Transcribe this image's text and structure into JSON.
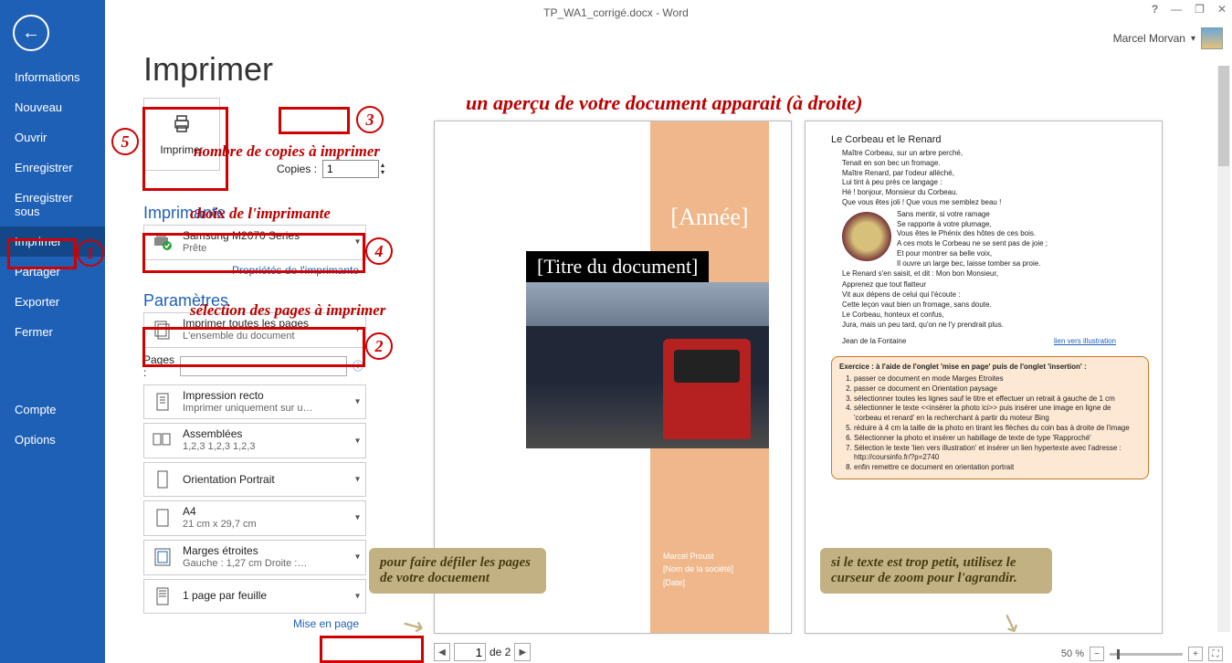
{
  "title": "TP_WA1_corrigé.docx - Word",
  "user": "Marcel Morvan",
  "sidebar": {
    "items": [
      "Informations",
      "Nouveau",
      "Ouvrir",
      "Enregistrer",
      "Enregistrer sous",
      "Imprimer",
      "Partager",
      "Exporter",
      "Fermer",
      "Compte",
      "Options"
    ],
    "active_index": 5
  },
  "print": {
    "heading": "Imprimer",
    "big_button": "Imprimer",
    "copies_label": "Copies :",
    "copies_value": "1",
    "printer_heading": "Imprimante",
    "printer_name": "Samsung M2070 Series",
    "printer_status": "Prête",
    "printer_props": "Propriétés de l'imprimante",
    "settings_heading": "Paramètres",
    "dd_pages_t1": "Imprimer toutes les pages",
    "dd_pages_t2": "L'ensemble du document",
    "pages_label": "Pages :",
    "dd_side_t1": "Impression recto",
    "dd_side_t2": "Imprimer uniquement sur u…",
    "dd_collate_t1": "Assemblées",
    "dd_collate_t2": "1,2,3    1,2,3    1,2,3",
    "dd_orient_t1": "Orientation Portrait",
    "dd_size_t1": "A4",
    "dd_size_t2": "21 cm x 29,7 cm",
    "dd_margin_t1": "Marges étroites",
    "dd_margin_t2": "Gauche :   1,27 cm    Droite :…",
    "dd_ppp_t1": "1 page par feuille",
    "page_setup": "Mise en page"
  },
  "preview": {
    "year": "[Année]",
    "doc_title": "[Titre du document]",
    "meta1": "Marcel Proust",
    "meta2": "[Nom de la société]",
    "meta3": "[Date]",
    "p2_title": "Le Corbeau et le Renard",
    "p2_body1": "Maître Corbeau, sur un arbre perché,\nTenait en son bec un fromage.\nMaître Renard, par l'odeur alléché,\nLui tint à peu près ce langage :\nHé ! bonjour, Monsieur du Corbeau.\nQue vous êtes joli !  Que vous me semblez beau !",
    "p2_body2": "Sans mentir, si votre ramage\nSe rapporte à votre plumage,\nVous êtes le Phénix des hôtes de ces bois.\nA ces mots le Corbeau ne se sent pas de joie ;\nEt pour montrer sa belle voix,\nIl ouvre un large bec, laisse tomber sa proie.\nLe Renard s'en saisit, et dit : Mon bon Monsieur,",
    "p2_body3": "Apprenez que tout flatteur\nVit aux dépens de celui qui l'écoute :\nCette leçon vaut bien un fromage, sans doute.\nLe Corbeau, honteux et confus,\nJura, mais un peu tard, qu'on ne l'y prendrait plus.",
    "p2_author": "Jean de la Fontaine",
    "p2_link": "lien vers illustration",
    "ex_head": "Exercice : à l'aide de l'onglet 'mise en page' puis de l'onglet 'insertion' :",
    "ex1": "passer ce document en mode Marges Etroites",
    "ex2": "passer ce document en Orientation paysage",
    "ex3": "sélectionner toutes les lignes sauf le titre et effectuer un retrait à gauche de 1 cm",
    "ex4": "sélectionner le texte <<insérer la photo ici>> puis insérer une image en ligne de 'corbeau et renard' en la recherchant à partir du moteur Bing",
    "ex5": "réduire à 4 cm la taille de la photo en tirant les flèches du coin bas à droite de l'image",
    "ex6": "Sélectionner la photo et insérer un habillage de texte de type 'Rapproché'",
    "ex7": "Sélection le texte 'lien vers illustration' et insérer un lien hypertexte avec l'adresse : http://coursinfo.fr/?p=2740",
    "ex8": "enfin remettre ce document en orientation portrait"
  },
  "pager": {
    "current": "1",
    "total": "de 2"
  },
  "zoom": {
    "label": "50 %"
  },
  "annot": {
    "top": "un aperçu de votre document apparait (à droite)",
    "copies": "nombre de copies à imprimer",
    "printer": "choix de l'imprimante",
    "pages": "sélection des pages à imprimer",
    "scroll": "pour faire défiler les pages de votre docuement",
    "zoom": "si le texte est trop petit, utilisez le curseur de zoom pour l'agrandir."
  }
}
